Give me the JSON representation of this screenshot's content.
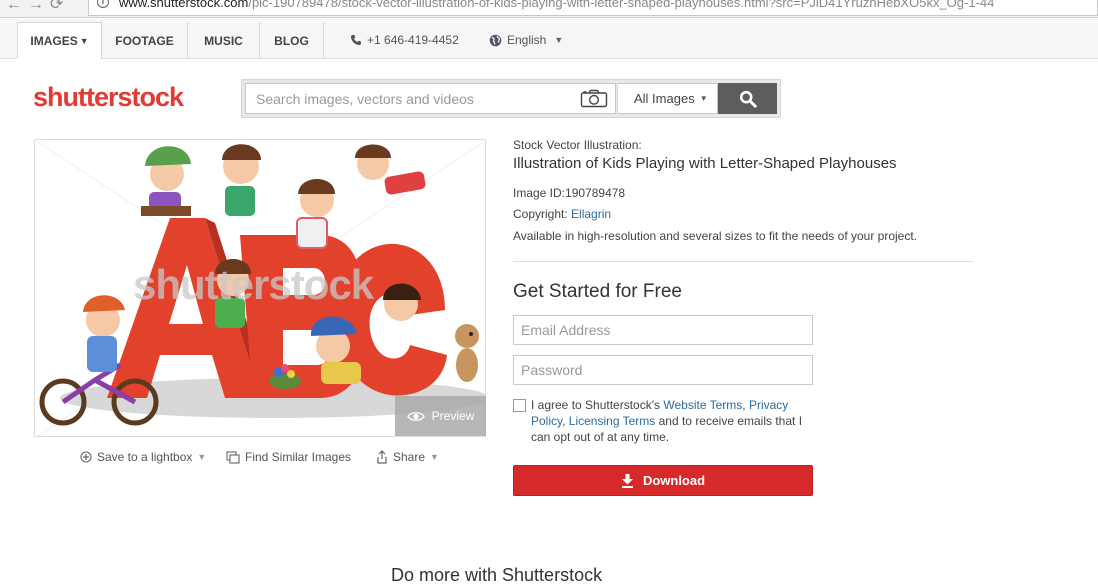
{
  "browser": {
    "url_domain": "www.shutterstock.com",
    "url_rest": "/pic-190789478/stock-vector-illustration-of-kids-playing-with-letter-shaped-playhouses.html?src=PJiD41YruzhHebXO5kx_Og-1-44"
  },
  "nav": {
    "tabs": [
      {
        "label": "IMAGES",
        "active": true
      },
      {
        "label": "FOOTAGE",
        "active": false
      },
      {
        "label": "MUSIC",
        "active": false
      },
      {
        "label": "BLOG",
        "active": false
      }
    ],
    "phone": "+1 646-419-4452",
    "language": "English"
  },
  "logo": {
    "text": "shutterstock",
    "color": "#e03c35"
  },
  "search": {
    "placeholder": "Search images, vectors and videos",
    "filter_selected": "All Images",
    "camera_icon": "camera-icon",
    "button_icon": "search-icon"
  },
  "image": {
    "watermark": "shutterstock",
    "preview_label": "Preview",
    "actions": {
      "save_label": "Save to a lightbox",
      "similar_label": "Find Similar Images",
      "share_label": "Share"
    }
  },
  "details": {
    "type_label": "Stock Vector Illustration:",
    "title": "Illustration of Kids Playing with Letter-Shaped Playhouses",
    "image_id_label": "Image ID:",
    "image_id": "190789478",
    "copyright_label": "Copyright:",
    "copyright_owner": "Ellagrin",
    "availability": "Available in high-resolution and several sizes to fit the needs of your project."
  },
  "signup": {
    "title": "Get Started for Free",
    "email_placeholder": "Email Address",
    "password_placeholder": "Password",
    "agree_prefix": "I agree to Shutterstock's ",
    "website_terms": "Website Terms",
    "privacy_policy": "Privacy Policy",
    "licensing_terms": "Licensing Terms",
    "agree_suffix": " and to receive emails that I can opt out of at any time.",
    "download_label": "Download",
    "button_color": "#d62a2a"
  },
  "bottom": {
    "title": "Do more with Shutterstock"
  }
}
